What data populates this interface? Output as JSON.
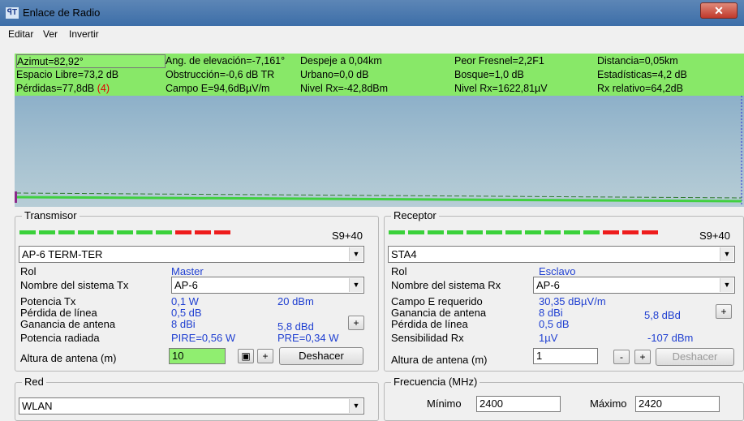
{
  "window": {
    "title": "Enlace de Radio",
    "icon": "antenna-icon",
    "close": "✕"
  },
  "menu": [
    "Editar",
    "Ver",
    "Invertir"
  ],
  "info": {
    "row1": [
      "Azimut=82,92°",
      "Ang. de elevación=-7,161°",
      "Despeje a 0,04km",
      "Peor Fresnel=2,2F1",
      "Distancia=0,05km"
    ],
    "row2": [
      "Espacio Libre=73,2 dB",
      "Obstrucción=-0,6 dB TR",
      "Urbano=0,0 dB",
      "Bosque=1,0 dB",
      "Estadísticas=4,2 dB"
    ],
    "row3_loss": "Pérdidas=77,8dB",
    "row3_loss_note": "(4)",
    "row3": [
      "Campo E=94,6dBµV/m",
      "Nivel Rx=-42,8dBm",
      "Nivel Rx=1622,81µV",
      "Rx relativo=64,2dB"
    ]
  },
  "transmitter": {
    "title": "Transmisor",
    "signal": "S9+40",
    "signal_green_segments": 7,
    "signal_red_segments": 3,
    "station": "AP-6 TERM-TER",
    "role_label": "Rol",
    "role_value": "Master",
    "system_label": "Nombre del sistema Tx",
    "system_value": "AP-6",
    "power_label": "Potencia Tx",
    "power_w": "0,1 W",
    "power_dbm": "20 dBm",
    "line_loss_label": "Pérdida de línea",
    "line_loss_value": "0,5 dB",
    "gain_label": "Ganancia de antena",
    "gain_dbi": "8 dBi",
    "gain_dbd": "5,8 dBd",
    "radiated_label": "Potencia radiada",
    "pire": "PIRE=0,56 W",
    "pre": "PRE=0,34 W",
    "height_label": "Altura de antena (m)",
    "height_value": "10",
    "undo_label": "Deshacer"
  },
  "receiver": {
    "title": "Receptor",
    "signal": "S9+40",
    "signal_green_segments": 11,
    "signal_red_segments": 3,
    "station": "STA4",
    "role_label": "Rol",
    "role_value": "Esclavo",
    "system_label": "Nombre del sistema Rx",
    "system_value": "AP-6",
    "field_label": "Campo E requerido",
    "field_value": "30,35 dBµV/m",
    "gain_label": "Ganancia de antena",
    "gain_dbi": "8 dBi",
    "gain_dbd": "5,8 dBd",
    "line_loss_label": "Pérdida de línea",
    "line_loss_value": "0,5 dB",
    "sens_label": "Sensibilidad Rx",
    "sens_uv": "1µV",
    "sens_dbm": "-107 dBm",
    "height_label": "Altura de antena (m)",
    "height_value": "1",
    "undo_label": "Deshacer"
  },
  "network": {
    "title": "Red",
    "value": "WLAN"
  },
  "frequency": {
    "title": "Frecuencia (MHz)",
    "min_label": "Mínimo",
    "min_value": "2400",
    "max_label": "Máximo",
    "max_value": "2420"
  },
  "buttons": {
    "plus": "+",
    "minus": "-",
    "small": "▣",
    "dropdown": "▼"
  }
}
